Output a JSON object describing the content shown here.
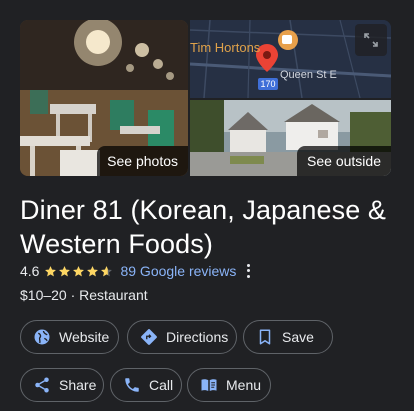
{
  "photos": {
    "main_label": "See photos",
    "street_label": "See outside",
    "map_place_label": "Tim Hortons",
    "map_street_label": "Queen St E",
    "map_route_badge": "170"
  },
  "place": {
    "name": "Diner 81 (Korean, Japanese & Western Foods)",
    "rating": "4.6",
    "rating_value": 4.6,
    "reviews": "89 Google reviews",
    "price_category": "$10–20 · Restaurant"
  },
  "actions": {
    "website": "Website",
    "directions": "Directions",
    "save": "Save",
    "share": "Share",
    "call": "Call",
    "menu": "Menu"
  },
  "colors": {
    "background": "#202124",
    "star": "#fdd663",
    "link": "#8ab4f8",
    "icon_accent": "#8ab4f8"
  }
}
